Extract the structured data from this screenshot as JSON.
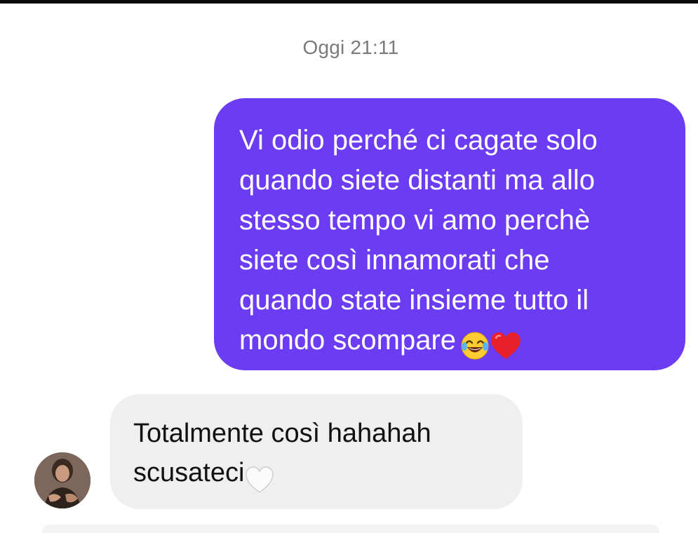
{
  "chat": {
    "timestamp": "Oggi 21:11",
    "sent_message": {
      "lines": [
        "Vi odio perché ci cagate solo",
        "quando siete distanti ma allo",
        "stesso tempo vi amo perchè",
        "siete così innamorati che",
        "quando state insieme tutto il",
        "mondo scompare"
      ],
      "emojis": [
        "laughing-tears-emoji",
        "red-heart-emoji"
      ],
      "bubble_color": "#6c3cf2"
    },
    "received_message": {
      "lines": [
        "Totalmente così hahahah",
        "scusateci"
      ],
      "emojis": [
        "white-heart-emoji"
      ],
      "bubble_color": "#efefef"
    }
  }
}
